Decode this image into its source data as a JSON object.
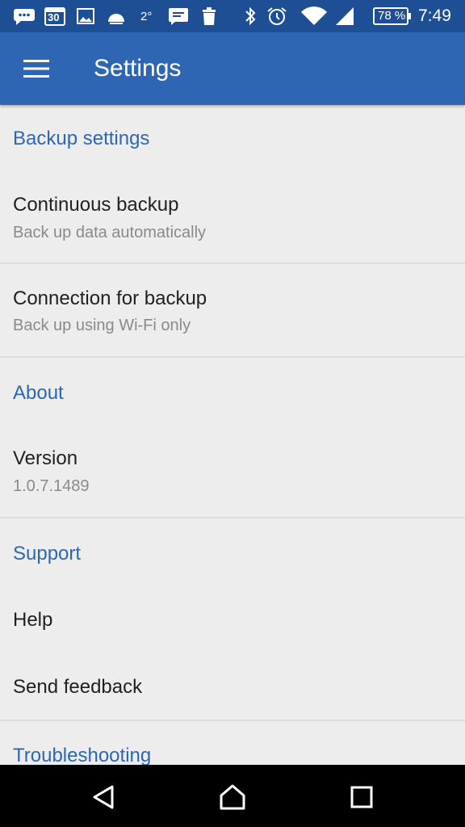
{
  "status_bar": {
    "calendar_day": "30",
    "temperature": "2°",
    "battery_percent": "78 %",
    "time": "7:49",
    "icons": [
      "messenger-icon",
      "calendar-icon",
      "image-icon",
      "weather-icon",
      "chat-icon",
      "trash-icon",
      "bluetooth-icon",
      "alarm-icon",
      "wifi-icon",
      "signal-icon",
      "battery-icon"
    ]
  },
  "app_bar": {
    "title": "Settings",
    "menu_icon": "menu-icon"
  },
  "sections": {
    "backup": {
      "header": "Backup settings",
      "continuous": {
        "title": "Continuous backup",
        "summary": "Back up data automatically"
      },
      "connection": {
        "title": "Connection for backup",
        "summary": "Back up using Wi-Fi only"
      }
    },
    "about": {
      "header": "About",
      "version": {
        "title": "Version",
        "summary": "1.0.7.1489"
      }
    },
    "support": {
      "header": "Support",
      "help": {
        "title": "Help"
      },
      "feedback": {
        "title": "Send feedback"
      }
    },
    "troubleshooting": {
      "header": "Troubleshooting"
    }
  },
  "nav_bar": {
    "icons": [
      "back-icon",
      "home-icon",
      "recents-icon"
    ]
  },
  "colors": {
    "status_bar": "#1e4f94",
    "app_bar": "#2e66b4",
    "accent": "#2e66b4",
    "background": "#ededed"
  }
}
